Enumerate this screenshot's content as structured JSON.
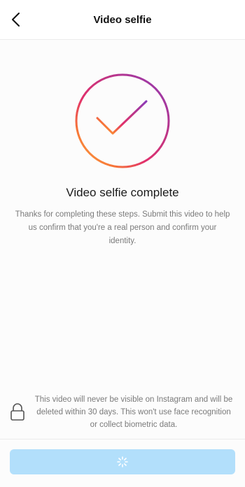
{
  "header": {
    "title": "Video selfie",
    "back_icon": "chevron-left-icon"
  },
  "status": {
    "icon": "checkmark-circle-icon",
    "gradient_colors": [
      "#8a3ab9",
      "#e1306c",
      "#fd1d1d",
      "#f77737",
      "#fcaf45"
    ],
    "title": "Video selfie complete",
    "description": "Thanks for completing these steps. Submit this video to help us confirm that you're a real person and confirm your identity."
  },
  "privacy": {
    "icon": "lock-icon",
    "text": "This video will never be visible on Instagram and will be deleted within 30 days. This won't use face recognition or collect biometric data."
  },
  "submit": {
    "state": "loading",
    "icon": "spinner-icon",
    "color": "#b2dffb"
  }
}
